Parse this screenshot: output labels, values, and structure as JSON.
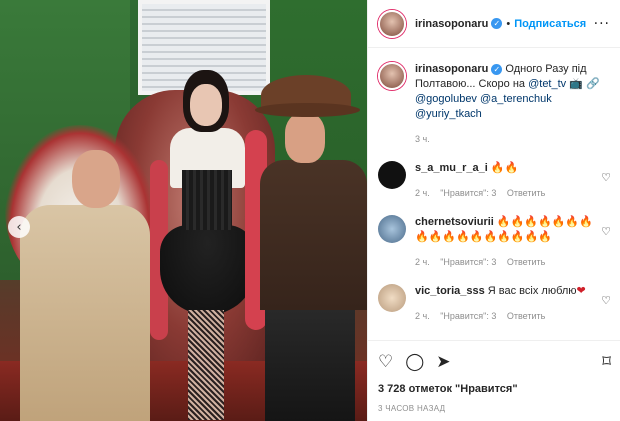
{
  "post": {
    "username": "irinasoponaru",
    "follow_label": "Подписаться",
    "dot": "•",
    "more_label": "···",
    "caption": {
      "username": "irinasoponaru",
      "text": "Одного Разу під Полтавою... Скоро на",
      "tags": [
        "@tet_tv",
        "@gogolubev",
        "@a_terenchuk",
        "@yuriy_tkach"
      ],
      "time": "3 ч."
    },
    "comments": [
      {
        "username": "s_a_mu_r_a_i",
        "text": "🔥🔥",
        "time": "2 ч.",
        "likes": "\"Нравится\": 3",
        "reply": "Ответить",
        "avatar_color": "#111111"
      },
      {
        "username": "chernetsoviurii",
        "text": "🔥🔥🔥🔥🔥🔥🔥🔥🔥🔥🔥🔥🔥🔥🔥🔥🔥",
        "time": "2 ч.",
        "likes": "\"Нравится\": 3",
        "reply": "Ответить",
        "avatar_color": "#6e8fb0"
      },
      {
        "username": "vic_toria_sss",
        "text": "Я вас всіх люблю",
        "heart": "❤",
        "time": "2 ч.",
        "likes": "\"Нравится\": 3",
        "reply": "Ответить",
        "avatar_color": "#d9c2a8"
      }
    ],
    "likes_count": "3 728 отметок \"Нравится\"",
    "posted_ago": "3 ЧАСОВ НАЗАД"
  },
  "icons": {
    "carousel_prev": "chevron-left-icon",
    "like": "heart-icon",
    "comment": "comment-icon",
    "share": "send-icon",
    "save": "bookmark-icon",
    "verified": "verified-badge-icon"
  },
  "colors": {
    "accent": "#0095f6",
    "verified": "#3897f0",
    "muted": "#8e8e8e"
  }
}
